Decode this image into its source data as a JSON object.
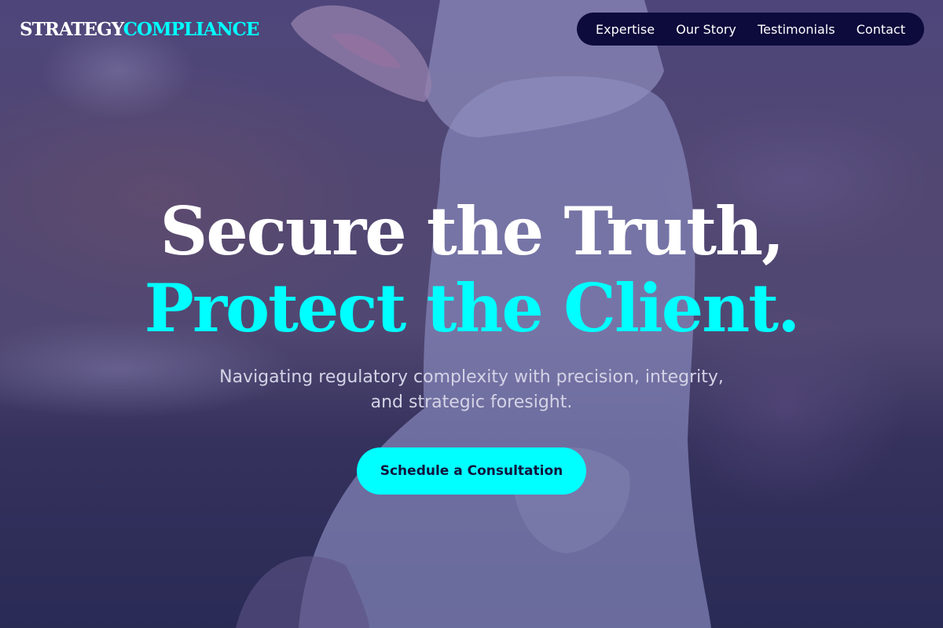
{
  "header": {
    "logo_part1": "STRATEGY",
    "logo_part2": "COMPLIANCE",
    "nav": [
      {
        "label": "Expertise"
      },
      {
        "label": "Our Story"
      },
      {
        "label": "Testimonials"
      },
      {
        "label": "Contact"
      }
    ]
  },
  "hero": {
    "headline_line1": "Secure the Truth,",
    "headline_line2": "Protect the Client.",
    "subheadline": "Navigating regulatory complexity with precision, integrity, and strategic foresight.",
    "cta_label": "Schedule a Consultation"
  },
  "colors": {
    "accent": "#00ffff",
    "nav_background": "#0d0a3c",
    "overlay": "#302e78"
  },
  "background_image": "puppy-photo"
}
